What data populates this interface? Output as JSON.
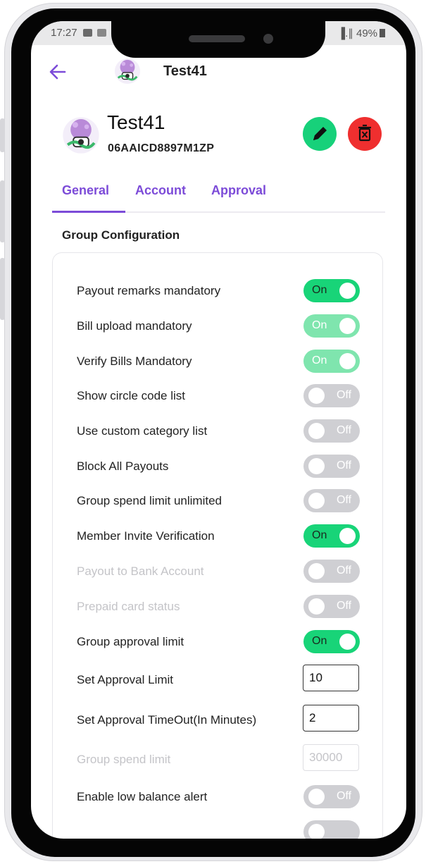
{
  "status_bar": {
    "time": "17:27",
    "signal": "▐.∥ 49%"
  },
  "header": {
    "title": "Test41"
  },
  "profile": {
    "name": "Test41",
    "gst": "06AAICD8897M1ZP"
  },
  "tabs": [
    {
      "label": "General",
      "active": true
    },
    {
      "label": "Account",
      "active": false
    },
    {
      "label": "Approval",
      "active": false
    }
  ],
  "section": {
    "title": "Group Configuration"
  },
  "settings": [
    {
      "label": "Payout remarks mandatory",
      "state": "On",
      "enabled": true
    },
    {
      "label": "Bill upload mandatory",
      "state": "On",
      "enabled": false
    },
    {
      "label": "Verify Bills Mandatory",
      "state": "On",
      "enabled": false
    },
    {
      "label": "Show circle code list",
      "state": "Off",
      "enabled": false
    },
    {
      "label": "Use custom category list",
      "state": "Off",
      "enabled": false
    },
    {
      "label": "Block All Payouts",
      "state": "Off",
      "enabled": false
    },
    {
      "label": "Group spend limit unlimited",
      "state": "Off",
      "enabled": false
    },
    {
      "label": "Member Invite Verification",
      "state": "On",
      "enabled": true
    },
    {
      "label": "Payout to Bank Account",
      "state": "Off",
      "enabled": false
    },
    {
      "label": "Prepaid card status",
      "state": "Off",
      "enabled": false
    },
    {
      "label": "Group approval limit",
      "state": "On",
      "enabled": true
    },
    {
      "label": "Set Approval Limit",
      "value": "10"
    },
    {
      "label": "Set Approval TimeOut(In Minutes)",
      "value": "2"
    },
    {
      "label": "Group spend limit",
      "value": "30000",
      "enabled": false
    },
    {
      "label": "Enable low balance alert",
      "state": "Off",
      "enabled": false
    }
  ],
  "colors": {
    "accent": "#7c4bd8",
    "on": "#18d478",
    "off": "#cfcfd3",
    "delete": "#ef2f2f"
  }
}
